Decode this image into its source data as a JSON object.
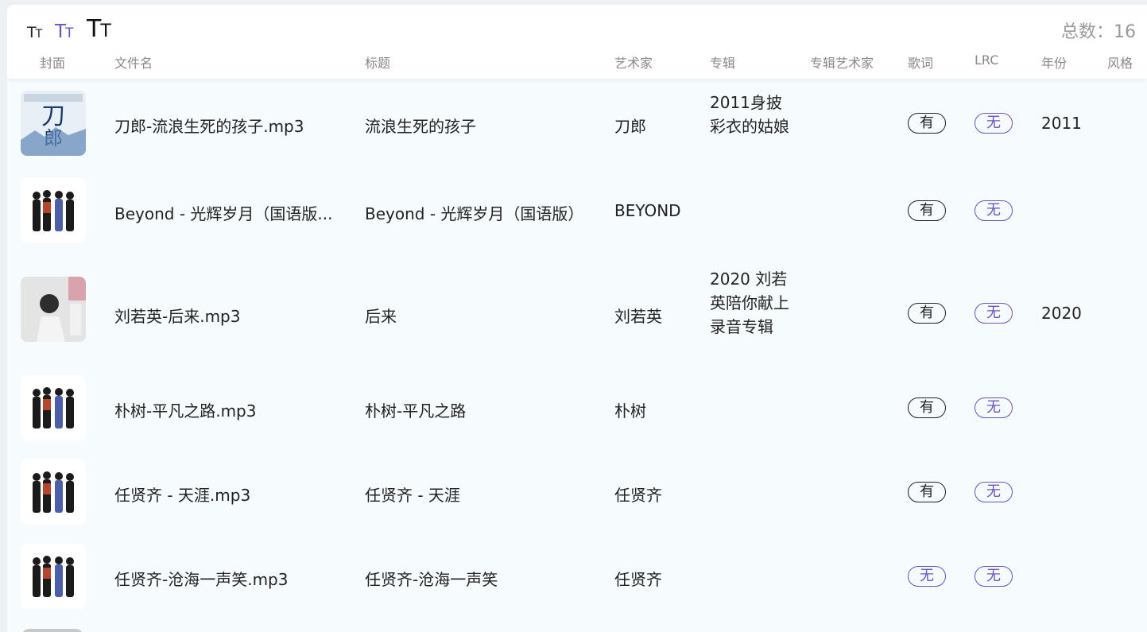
{
  "toolbar": {
    "font_small": [
      "T",
      "T"
    ],
    "font_medium": [
      "T",
      "T"
    ],
    "font_large": [
      "T",
      "T"
    ],
    "total": "总数：16"
  },
  "columns": [
    "封面",
    "文件名",
    "标题",
    "艺术家",
    "专辑",
    "专辑艺术家",
    "歌词",
    "LRC",
    "年份",
    "风格"
  ],
  "rows": [
    {
      "filename": "刀郎-流浪生死的孩子.mp3",
      "title": "流浪生死的孩子",
      "artist": "刀郎",
      "album": "2011身披彩衣的姑娘",
      "album_artist": "",
      "lyrics": "有",
      "lrc": "无",
      "year": "2011",
      "genre": "",
      "cover": "daolang-cover"
    },
    {
      "filename": "Beyond - 光辉岁月（国语版...",
      "title": "Beyond - 光辉岁月（国语版）",
      "artist": "BEYOND",
      "album": "",
      "album_artist": "",
      "lyrics": "有",
      "lrc": "无",
      "year": "",
      "genre": "",
      "cover": "band-cover"
    },
    {
      "filename": "刘若英-后来.mp3",
      "title": "后来",
      "artist": "刘若英",
      "album": "2020 刘若英陪你献上录音专辑",
      "album_artist": "",
      "lyrics": "有",
      "lrc": "无",
      "year": "2020",
      "genre": "",
      "cover": "liuruoying-cover"
    },
    {
      "filename": "朴树-平凡之路.mp3",
      "title": "朴树-平凡之路",
      "artist": "朴树",
      "album": "",
      "album_artist": "",
      "lyrics": "有",
      "lrc": "无",
      "year": "",
      "genre": "",
      "cover": "band-cover"
    },
    {
      "filename": "任贤齐 - 天涯.mp3",
      "title": "任贤齐 - 天涯",
      "artist": "任贤齐",
      "album": "",
      "album_artist": "",
      "lyrics": "有",
      "lrc": "无",
      "year": "",
      "genre": "",
      "cover": "band-cover"
    },
    {
      "filename": "任贤齐-沧海一声笑.mp3",
      "title": "任贤齐-沧海一声笑",
      "artist": "任贤齐",
      "album": "",
      "album_artist": "",
      "lyrics": "无",
      "lrc": "无",
      "year": "",
      "genre": "",
      "cover": "band-cover"
    }
  ],
  "colors": {
    "accent": "#6a52c7",
    "muted": "#9a9a9a",
    "background": "#f6fbfd"
  }
}
